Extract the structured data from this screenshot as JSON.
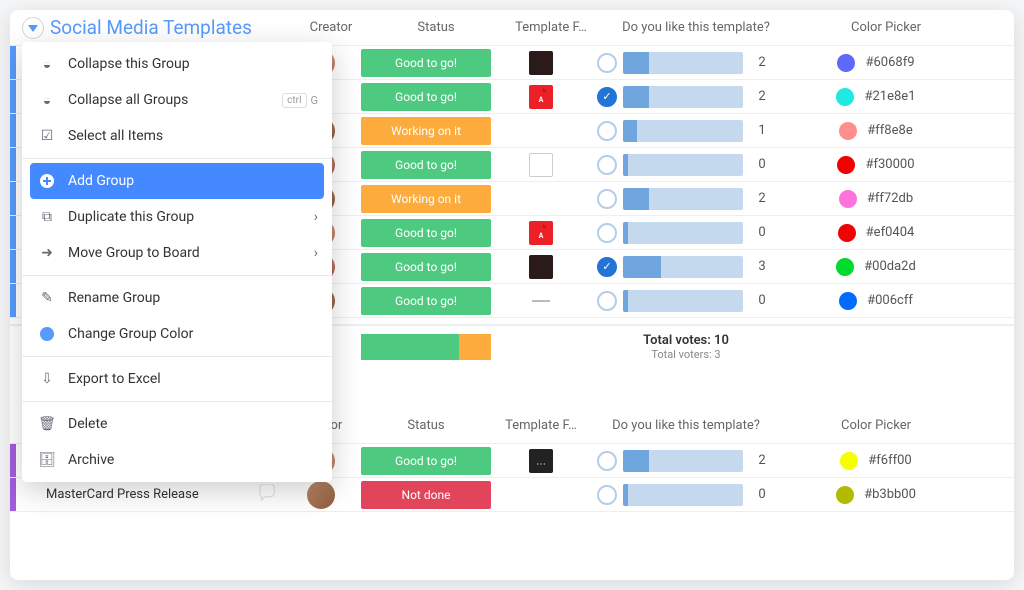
{
  "group1": {
    "title": "Social Media Templates",
    "headers": {
      "creator": "Creator",
      "status": "Status",
      "file": "Template F…",
      "vote": "Do you like this template?",
      "color": "Color Picker"
    },
    "rows": [
      {
        "status": "Good to go!",
        "statusClass": "s-good",
        "avatar": "m1",
        "file": "dark",
        "voted": false,
        "fill": 22,
        "count": 2,
        "swatch": "#6068f9",
        "hex": "#6068f9"
      },
      {
        "status": "Good to go!",
        "statusClass": "s-good",
        "avatar": "pencil",
        "file": "pdf",
        "voted": true,
        "fill": 22,
        "count": 2,
        "swatch": "#21e8e1",
        "hex": "#21e8e1"
      },
      {
        "status": "Working on it",
        "statusClass": "s-working",
        "avatar": "f1",
        "file": "none",
        "voted": false,
        "fill": 12,
        "count": 1,
        "swatch": "#ff8e8e",
        "hex": "#ff8e8e"
      },
      {
        "status": "Good to go!",
        "statusClass": "s-good",
        "avatar": "m2",
        "file": "page",
        "voted": false,
        "fill": 4,
        "count": 0,
        "swatch": "#f30000",
        "hex": "#f30000"
      },
      {
        "status": "Working on it",
        "statusClass": "s-working",
        "avatar": "f1",
        "file": "none",
        "voted": false,
        "fill": 22,
        "count": 2,
        "swatch": "#ff72db",
        "hex": "#ff72db"
      },
      {
        "status": "Good to go!",
        "statusClass": "s-good",
        "avatar": "m1",
        "file": "pdf",
        "voted": false,
        "fill": 4,
        "count": 0,
        "swatch": "#ef0404",
        "hex": "#ef0404"
      },
      {
        "status": "Good to go!",
        "statusClass": "s-good",
        "avatar": "m2",
        "file": "dark",
        "voted": true,
        "fill": 32,
        "count": 3,
        "swatch": "#00da2d",
        "hex": "#00da2d"
      },
      {
        "status": "Good to go!",
        "statusClass": "s-good",
        "avatar": "f1",
        "file": "line",
        "voted": false,
        "fill": 4,
        "count": 0,
        "swatch": "#006cff",
        "hex": "#006cff"
      }
    ],
    "totals": {
      "votes": "Total votes: 10",
      "voters": "Total voters: 3"
    }
  },
  "menu": {
    "collapse_this": "Collapse this Group",
    "collapse_all": "Collapse all Groups",
    "select_all": "Select all Items",
    "add_group": "Add Group",
    "duplicate": "Duplicate this Group",
    "move": "Move Group to Board",
    "rename": "Rename Group",
    "change_color": "Change Group Color",
    "export": "Export to Excel",
    "delete": "Delete",
    "archive": "Archive",
    "kbd_ctrl": "ctrl",
    "kbd_g": "G"
  },
  "group2": {
    "headers": {
      "creator": "Creator",
      "status": "Status",
      "file": "Template F…",
      "vote": "Do you like this template?",
      "color": "Color Picker"
    },
    "rows": [
      {
        "name": "",
        "status": "Good to go!",
        "statusClass": "s-good",
        "avatar": "m1",
        "file": "dots",
        "voted": false,
        "fill": 22,
        "count": 2,
        "swatch": "#f6ff00",
        "hex": "#f6ff00"
      },
      {
        "name": "MasterCard Press Release",
        "status": "Not done",
        "statusClass": "s-notdone",
        "avatar": "f1",
        "file": "none",
        "voted": false,
        "fill": 4,
        "count": 0,
        "swatch": "#b3bb00",
        "hex": "#b3bb00"
      }
    ]
  }
}
